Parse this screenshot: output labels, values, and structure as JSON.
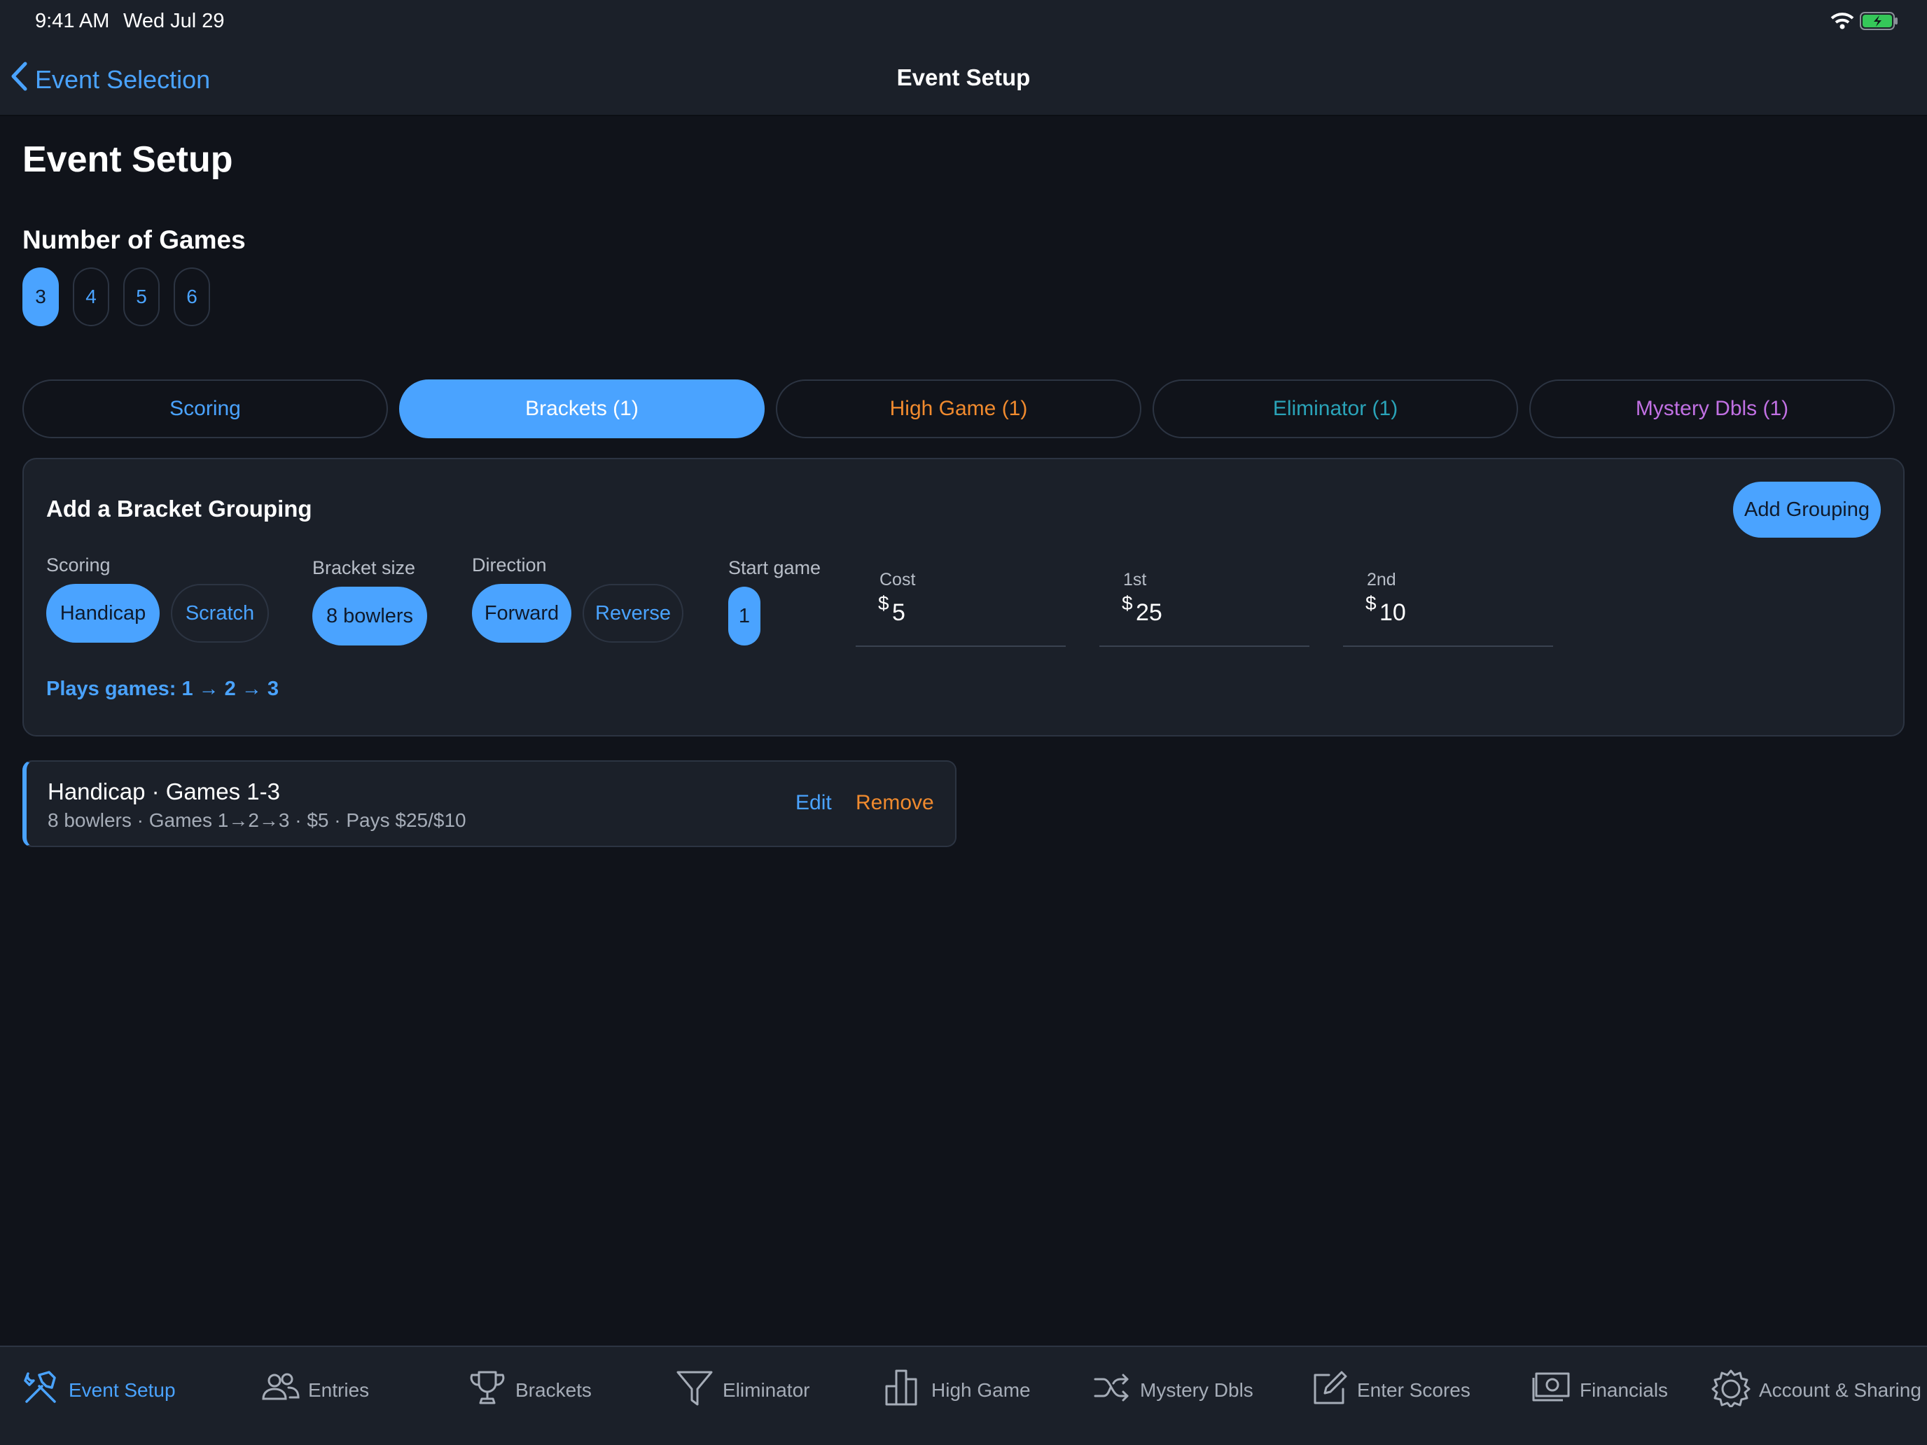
{
  "status": {
    "time": "9:41 AM",
    "date": "Wed Jul 29"
  },
  "nav": {
    "back_label": "Event Selection",
    "title": "Event Setup"
  },
  "page": {
    "title": "Event Setup"
  },
  "games": {
    "label": "Number of Games",
    "options": [
      "3",
      "4",
      "5",
      "6"
    ],
    "selected": "3"
  },
  "tabs": [
    {
      "label": "Scoring"
    },
    {
      "label": "Brackets (1)"
    },
    {
      "label": "High Game (1)"
    },
    {
      "label": "Eliminator (1)"
    },
    {
      "label": "Mystery Dbls (1)"
    }
  ],
  "form": {
    "title": "Add a Bracket Grouping",
    "add_button": "Add Grouping",
    "scoring_label": "Scoring",
    "scoring_options": [
      "Handicap",
      "Scratch"
    ],
    "bracket_size_label": "Bracket size",
    "bracket_size_value": "8 bowlers",
    "direction_label": "Direction",
    "direction_options": [
      "Forward",
      "Reverse"
    ],
    "start_game_label": "Start game",
    "start_game_value": "1",
    "currency": "$",
    "cost_label": "Cost",
    "cost_value": "5",
    "first_label": "1st",
    "first_value": "25",
    "second_label": "2nd",
    "second_value": "10",
    "plays_games": "Plays games: 1 → 2 → 3"
  },
  "groupings": [
    {
      "title": "Handicap · Games 1-3",
      "subtitle": "8 bowlers · Games 1→2→3 · $5 · Pays $25/$10",
      "edit": "Edit",
      "remove": "Remove"
    }
  ],
  "tabbar": [
    {
      "label": "Event Setup",
      "icon": "hammer-wrench-icon"
    },
    {
      "label": "Entries",
      "icon": "people-icon"
    },
    {
      "label": "Brackets",
      "icon": "trophy-icon"
    },
    {
      "label": "Eliminator",
      "icon": "funnel-icon"
    },
    {
      "label": "High Game",
      "icon": "bar-chart-icon"
    },
    {
      "label": "Mystery Dbls",
      "icon": "shuffle-icon"
    },
    {
      "label": "Enter Scores",
      "icon": "edit-square-icon"
    },
    {
      "label": "Financials",
      "icon": "banknote-icon"
    },
    {
      "label": "Account & Sharing",
      "icon": "gear-icon"
    }
  ],
  "colors": {
    "accent": "#4aa3ff",
    "orange": "#f08a2e",
    "teal": "#2aa3b8",
    "purple": "#c170e3",
    "background": "#10131a",
    "surface": "#1b2029"
  }
}
